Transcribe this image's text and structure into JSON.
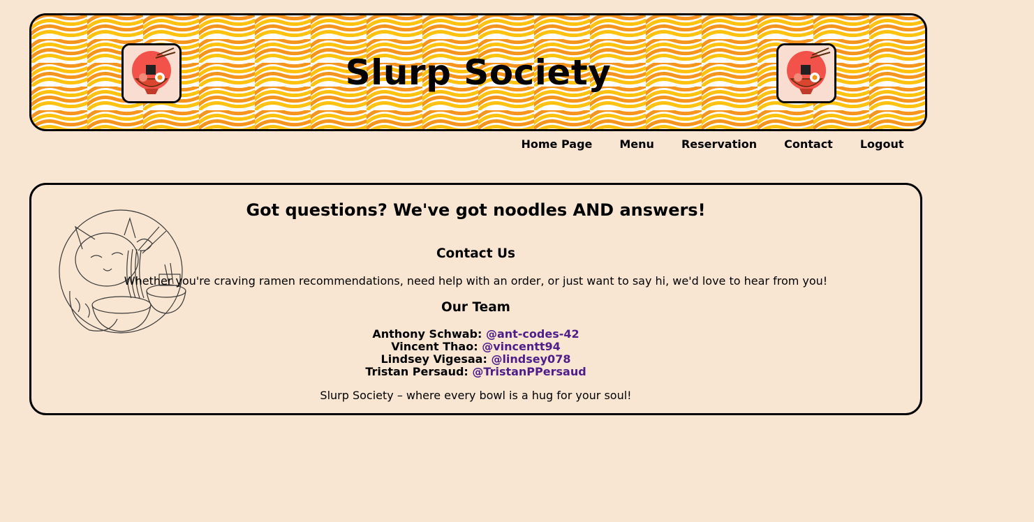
{
  "header": {
    "title": "Slurp Society",
    "logo_icon": "ramen-bowl-icon"
  },
  "nav": {
    "items": [
      {
        "label": "Home Page"
      },
      {
        "label": "Menu"
      },
      {
        "label": "Reservation"
      },
      {
        "label": "Contact"
      },
      {
        "label": "Logout"
      }
    ]
  },
  "contact": {
    "headline": "Got questions? We've got noodles AND answers!",
    "illustration": "cat-eating-noodles-icon",
    "contact_heading": "Contact Us",
    "contact_text": "Whether you're craving ramen recommendations, need help with an order, or just want to say hi, we'd love to hear from you!",
    "team_heading": "Our Team",
    "team": [
      {
        "name": "Anthony Schwab:",
        "handle": "@ant-codes-42"
      },
      {
        "name": "Vincent Thao:",
        "handle": "@vincentt94"
      },
      {
        "name": "Lindsey Vigesaa:",
        "handle": "@lindsey078"
      },
      {
        "name": "Tristan Persaud:",
        "handle": "@TristanPPersaud"
      }
    ],
    "tagline": "Slurp Society – where every bowl is a hug for your soul!"
  },
  "colors": {
    "page_bg": "#f8e6d2",
    "wave_orange": "#f7941d",
    "wave_yellow": "#ffc20e",
    "link_purple": "#4e1d8a"
  }
}
